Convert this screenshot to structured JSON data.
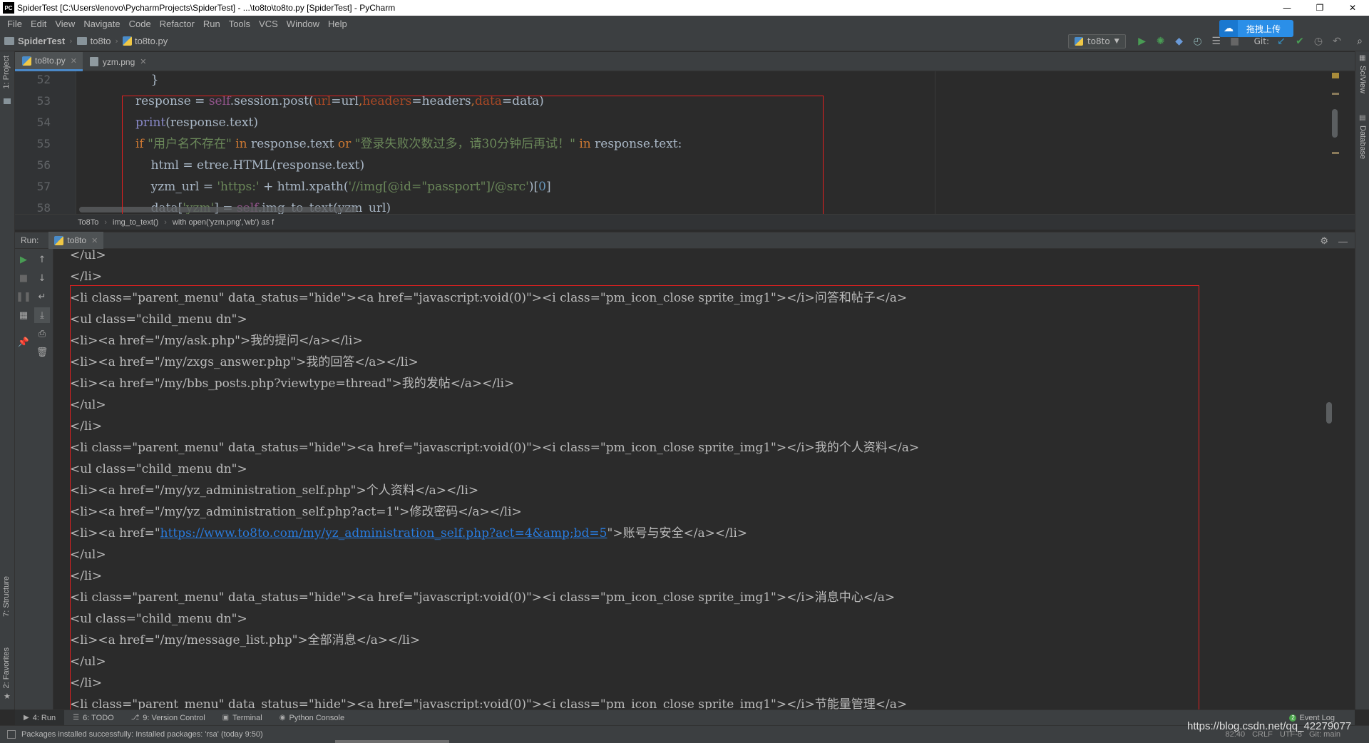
{
  "window": {
    "title": "SpiderTest [C:\\Users\\lenovo\\PycharmProjects\\SpiderTest] - ...\\to8to\\to8to.py [SpiderTest] - PyCharm",
    "app_icon": "PC",
    "controls": [
      "—",
      "❐",
      "✕"
    ]
  },
  "menu": [
    "File",
    "Edit",
    "View",
    "Navigate",
    "Code",
    "Refactor",
    "Run",
    "Tools",
    "VCS",
    "Window",
    "Help"
  ],
  "baidu_upload": "拖拽上传",
  "navbar": {
    "crumbs": [
      "SpiderTest",
      "to8to",
      "to8to.py"
    ],
    "run_config": "to8to",
    "git_label": "Git:"
  },
  "left_strip": {
    "project": "1: Project",
    "structure": "7: Structure",
    "favorites": "2: Favorites"
  },
  "right_strip": {
    "sciview": "SciView",
    "database": "Database"
  },
  "editor": {
    "tabs": [
      {
        "label": "to8to.py",
        "active": true
      },
      {
        "label": "yzm.png",
        "active": false
      }
    ],
    "breadcrumb": [
      "To8To",
      "img_to_text()",
      "with open('yzm.png','wb') as f"
    ]
  },
  "run": {
    "label": "Run:",
    "tab": "to8to",
    "link": "https://www.to8to.com/my/yz_administration_self.php?act=4&amp;bd=5"
  },
  "console_lines": [
    "</ul>",
    "</li>",
    "<li class=\"parent_menu\" data_status=\"hide\"><a href=\"javascript:void(0)\"><i class=\"pm_icon_close sprite_img1\"></i>问答和帖子</a>",
    "<ul class=\"child_menu dn\">",
    "<li><a href=\"/my/ask.php\">我的提问</a></li>",
    "<li><a href=\"/my/zxgs_answer.php\">我的回答</a></li>",
    "<li><a href=\"/my/bbs_posts.php?viewtype=thread\">我的发帖</a></li>",
    "</ul>",
    "</li>",
    "<li class=\"parent_menu\" data_status=\"hide\"><a href=\"javascript:void(0)\"><i class=\"pm_icon_close sprite_img1\"></i>我的个人资料</a>",
    "<ul class=\"child_menu dn\">",
    "<li><a href=\"/my/yz_administration_self.php\">个人资料</a></li>",
    "<li><a href=\"/my/yz_administration_self.php?act=1\">修改密码</a></li>",
    "LINK_LINE",
    "</ul>",
    "</li>",
    "<li class=\"parent_menu\" data_status=\"hide\"><a href=\"javascript:void(0)\"><i class=\"pm_icon_close sprite_img1\"></i>消息中心</a>",
    "<ul class=\"child_menu dn\">",
    "<li><a href=\"/my/message_list.php\">全部消息</a></li>",
    "</ul>",
    "</li>",
    "<li class=\"parent_menu\" data_status=\"hide\"><a href=\"javascript:void(0)\"><i class=\"pm_icon_close sprite_img1\"></i>节能量管理</a>"
  ],
  "console_link_line": {
    "prefix": "<li><a href=\"",
    "suffix": "\">账号与安全</a></li>"
  },
  "tool_tabs": [
    {
      "label": "4: Run",
      "icon": "▶",
      "active": true
    },
    {
      "label": "6: TODO",
      "icon": "☰",
      "active": false
    },
    {
      "label": "9: Version Control",
      "icon": "⎇",
      "active": false
    },
    {
      "label": "Terminal",
      "icon": "▣",
      "active": false
    },
    {
      "label": "Python Console",
      "icon": "◉",
      "active": false
    }
  ],
  "event_log": "Event Log",
  "status": {
    "message": "Packages installed successfully: Installed packages: 'rsa' (today 9:50)",
    "right": [
      "82:40",
      "CRLF",
      "UTF-8",
      "Git: main"
    ]
  },
  "watermark": "https://blog.csdn.net/qq_42279077",
  "colors": {
    "highlight_box": "#e02020",
    "link": "#287bde",
    "keyword": "#cc7832",
    "string": "#6a8759"
  }
}
